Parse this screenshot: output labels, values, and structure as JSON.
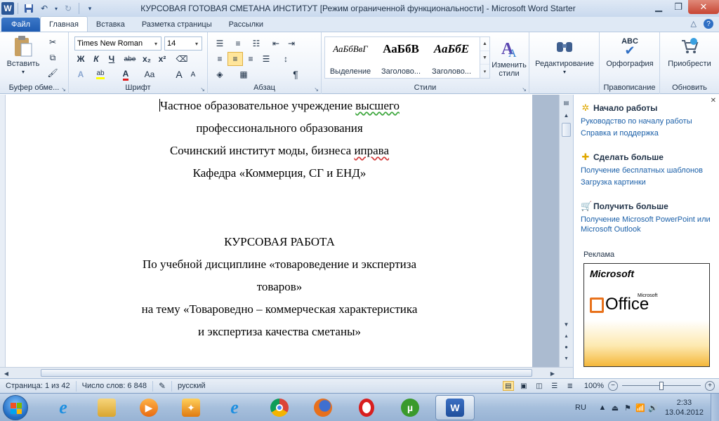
{
  "window": {
    "title": "КУРСОВАЯ ГОТОВАЯ СМЕТАНА ИНСТИТУТ [Режим ограниченной функциональности]  -  Microsoft Word Starter",
    "app_icon": "W"
  },
  "tabs": [
    {
      "label": "Файл"
    },
    {
      "label": "Главная"
    },
    {
      "label": "Вставка"
    },
    {
      "label": "Разметка страницы"
    },
    {
      "label": "Рассылки"
    }
  ],
  "ribbon": {
    "clipboard": {
      "paste_label": "Вставить",
      "group_label": "Буфер обме..."
    },
    "font": {
      "font_name": "Times New Roman",
      "font_size": "14",
      "bold": "Ж",
      "italic": "К",
      "underline": "Ч",
      "strike": "abe",
      "subscript": "x₂",
      "superscript": "x²",
      "change_case": "Aa",
      "grow": "A",
      "shrink": "A",
      "group_label": "Шрифт"
    },
    "paragraph": {
      "pilcrow": "¶",
      "group_label": "Абзац"
    },
    "styles": {
      "items": [
        {
          "preview": "АаБбВвГ",
          "name": "Выделение"
        },
        {
          "preview": "АаБбВ",
          "name": "Заголово..."
        },
        {
          "preview": "АаБбЕ",
          "name": "Заголово..."
        }
      ],
      "change_styles_label": "Изменить стили",
      "group_label": "Стили"
    },
    "editing": {
      "label": "Редактирование"
    },
    "proofing": {
      "spelling_label": "Орфография",
      "group_label": "Правописание",
      "abc": "ABC"
    },
    "update": {
      "apps_label": "Приобрести",
      "group_label": "Обновить"
    }
  },
  "document": {
    "lines": [
      {
        "parts": [
          "Частное образовательное учреждение ",
          "высшего"
        ],
        "squiggle": "green"
      },
      {
        "parts": [
          "профессионального образования"
        ]
      },
      {
        "parts": [
          "Сочинский институт моды, бизнеса ",
          "иправа"
        ],
        "squiggle": "red"
      },
      {
        "parts": [
          "Кафедра «Коммерция, СГ и ЕНД»"
        ]
      },
      {
        "parts": [
          "КУРСОВАЯ РАБОТА"
        ]
      },
      {
        "parts": [
          "По учебной дисциплине «товароведение и экспертиза"
        ]
      },
      {
        "parts": [
          "товаров»"
        ]
      },
      {
        "parts": [
          "на тему «Товароведно – коммерческая характеристика"
        ]
      },
      {
        "parts": [
          "и экспертиза качества сметаны»"
        ]
      }
    ]
  },
  "taskpane": {
    "sections": [
      {
        "title": "Начало работы",
        "links": [
          "Руководство по началу работы",
          "Справка и поддержка"
        ]
      },
      {
        "title": "Сделать больше",
        "links": [
          "Получение бесплатных шаблонов",
          "Загрузка картинки"
        ]
      },
      {
        "title": "Получить больше",
        "links": [
          "Получение Microsoft PowerPoint или Microsoft Outlook"
        ]
      }
    ],
    "ad_label": "Реклама",
    "ad_brand": "Microsoft",
    "ad_product": "Office",
    "ad_brand_small": "Microsoft"
  },
  "statusbar": {
    "page": "Страница: 1 из 42",
    "words": "Число слов: 6 848",
    "language": "русский",
    "zoom": "100%",
    "zoom_level": 0.5
  },
  "taskbar": {
    "lang": "RU",
    "time": "2:33",
    "date": "13.04.2012"
  },
  "colors": {
    "accent": "#2b5797",
    "file_tab": "#1f5cb2",
    "link": "#1a5fa8"
  }
}
